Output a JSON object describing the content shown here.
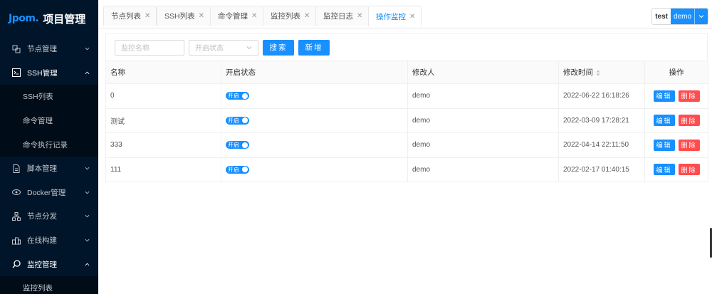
{
  "logo": {
    "mark": "Jpom.",
    "title": "项目管理"
  },
  "sidebar": {
    "items": [
      {
        "label": "节点管理",
        "icon": "nodes-icon",
        "open": false
      },
      {
        "label": "SSH管理",
        "icon": "terminal-icon",
        "open": true,
        "children": [
          "SSH列表",
          "命令管理",
          "命令执行记录"
        ]
      },
      {
        "label": "脚本管理",
        "icon": "file-icon",
        "open": false
      },
      {
        "label": "Docker管理",
        "icon": "docker-icon",
        "open": false
      },
      {
        "label": "节点分发",
        "icon": "cluster-icon",
        "open": false
      },
      {
        "label": "在线构建",
        "icon": "build-icon",
        "open": false
      },
      {
        "label": "监控管理",
        "icon": "search-icon",
        "open": true,
        "children": [
          "监控列表"
        ]
      }
    ]
  },
  "tabs": [
    {
      "label": "节点列表",
      "active": false
    },
    {
      "label": "SSH列表",
      "active": false
    },
    {
      "label": "命令管理",
      "active": false
    },
    {
      "label": "监控列表",
      "active": false
    },
    {
      "label": "监控日志",
      "active": false
    },
    {
      "label": "操作监控",
      "active": true
    }
  ],
  "user": {
    "workspace": "test",
    "name": "demo"
  },
  "filter": {
    "name_placeholder": "监控名称",
    "status_placeholder": "开启状态",
    "search_label": "搜索",
    "add_label": "新增"
  },
  "table": {
    "headers": {
      "name": "名称",
      "status": "开启状态",
      "modifier": "修改人",
      "time": "修改时间",
      "ops": "操作"
    },
    "switch_label": "开启",
    "edit_label": "编辑",
    "delete_label": "删除",
    "rows": [
      {
        "name": "0",
        "modifier": "demo",
        "time": "2022-06-22 16:18:26"
      },
      {
        "name": "测试",
        "modifier": "demo",
        "time": "2022-03-09 17:28:21"
      },
      {
        "name": "333",
        "modifier": "demo",
        "time": "2022-04-14 22:11:50"
      },
      {
        "name": "111",
        "modifier": "demo",
        "time": "2022-02-17 01:40:15"
      }
    ]
  },
  "colors": {
    "primary": "#1890ff",
    "danger": "#ff4d4f",
    "sidebar": "#001529",
    "submenu": "#000c17"
  }
}
